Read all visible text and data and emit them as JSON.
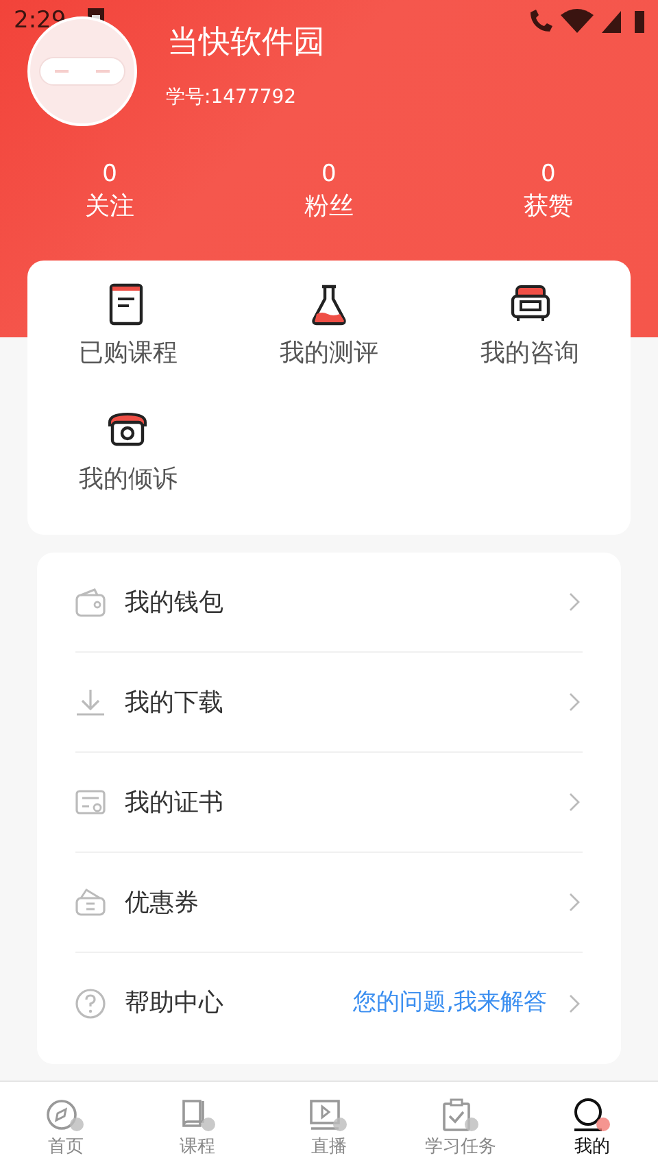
{
  "status_bar": {
    "time": "2:29"
  },
  "profile": {
    "name": "当快软件园",
    "student_id": "学号:1477792"
  },
  "stats": [
    {
      "value": "0",
      "label": "关注"
    },
    {
      "value": "0",
      "label": "粉丝"
    },
    {
      "value": "0",
      "label": "获赞"
    }
  ],
  "shortcuts": [
    {
      "kind": "book",
      "label": "已购课程"
    },
    {
      "kind": "flask",
      "label": "我的测评"
    },
    {
      "kind": "sofa",
      "label": "我的咨询"
    },
    {
      "kind": "phone",
      "label": "我的倾诉"
    }
  ],
  "menu": [
    {
      "kind": "wallet",
      "label": "我的钱包"
    },
    {
      "kind": "download",
      "label": "我的下载"
    },
    {
      "kind": "certificate",
      "label": "我的证书"
    },
    {
      "kind": "coupon",
      "label": "优惠券"
    },
    {
      "kind": "help",
      "label": "帮助中心",
      "note": "您的问题,我来解答"
    }
  ],
  "tab_bar": [
    {
      "kind": "compass",
      "label": "首页",
      "selected": false
    },
    {
      "kind": "book",
      "label": "课程",
      "selected": false
    },
    {
      "kind": "play",
      "label": "直播",
      "selected": false
    },
    {
      "kind": "clipboard",
      "label": "学习任务",
      "selected": false
    },
    {
      "kind": "person",
      "label": "我的",
      "selected": true
    }
  ]
}
